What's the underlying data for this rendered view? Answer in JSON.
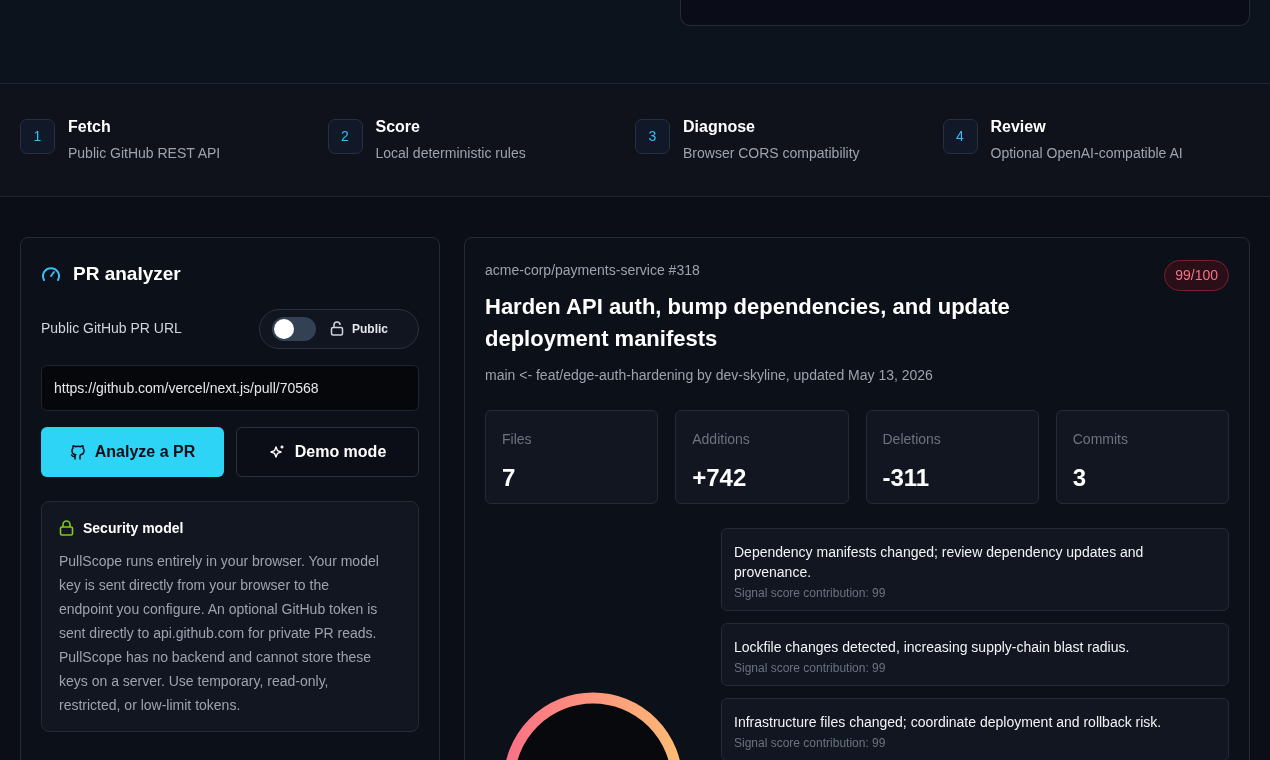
{
  "steps": [
    {
      "number": "1",
      "title": "Fetch",
      "subtitle": "Public GitHub REST API"
    },
    {
      "number": "2",
      "title": "Score",
      "subtitle": "Local deterministic rules"
    },
    {
      "number": "3",
      "title": "Diagnose",
      "subtitle": "Browser CORS compatibility"
    },
    {
      "number": "4",
      "title": "Review",
      "subtitle": "Optional OpenAI-compatible AI"
    }
  ],
  "analyzer": {
    "title": "PR analyzer",
    "url_label": "Public GitHub PR URL",
    "private_toggle": {
      "on": false,
      "label": "Public"
    },
    "url_value": "https://github.com/vercel/next.js/pull/70568",
    "buttons": [
      {
        "kind": "primary",
        "label": "Analyze a PR"
      },
      {
        "kind": "secondary",
        "label": "Demo mode"
      }
    ],
    "security": {
      "title": "Security model",
      "body": "PullScope runs entirely in your browser. Your model key is sent directly from your browser to the endpoint you configure. An optional GitHub token is sent directly to api.github.com for private PR reads. PullScope has no backend and cannot store these keys on a server. Use temporary, read-only, restricted, or low-limit tokens."
    }
  },
  "result": {
    "repo": "acme-corp/payments-service #318",
    "score_badge": "99/100",
    "title": "Harden API auth, bump dependencies, and update deployment manifests",
    "meta": "main <- feat/edge-auth-hardening by dev-skyline, updated May 13, 2026",
    "stats": [
      {
        "label": "Files",
        "value": "7"
      },
      {
        "label": "Additions",
        "value": "+742"
      },
      {
        "label": "Deletions",
        "value": "-311"
      },
      {
        "label": "Commits",
        "value": "3"
      }
    ],
    "signals": [
      {
        "text": "Dependency manifests changed; review dependency updates and provenance.",
        "contribution": "Signal score contribution: 99"
      },
      {
        "text": "Lockfile changes detected, increasing supply-chain blast radius.",
        "contribution": "Signal score contribution: 99"
      },
      {
        "text": "Infrastructure files changed; coordinate deployment and rollback risk.",
        "contribution": "Signal score contribution: 99"
      }
    ]
  }
}
